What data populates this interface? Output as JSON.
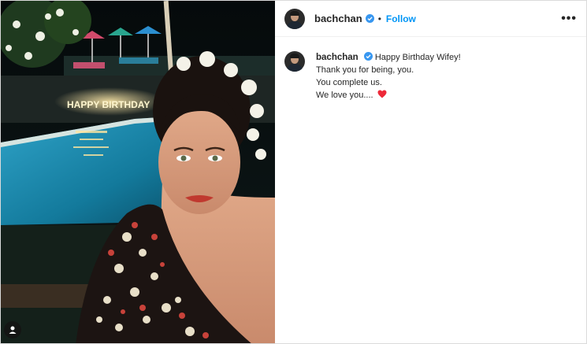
{
  "post": {
    "username": "bachchan",
    "verified": true,
    "follow_label": "Follow",
    "separator": "•",
    "more_label": "•••"
  },
  "caption": {
    "username": "bachchan",
    "lines": [
      "Happy Birthday Wifey!",
      "Thank you for being, you.",
      "You complete us.",
      "We love you...."
    ],
    "emoji": "red-heart-icon"
  },
  "photo": {
    "sign_text": "HAPPY BIRTHDAY"
  },
  "colors": {
    "follow": "#0095f6",
    "verified": "#3897f0",
    "heart": "#ed2939"
  }
}
